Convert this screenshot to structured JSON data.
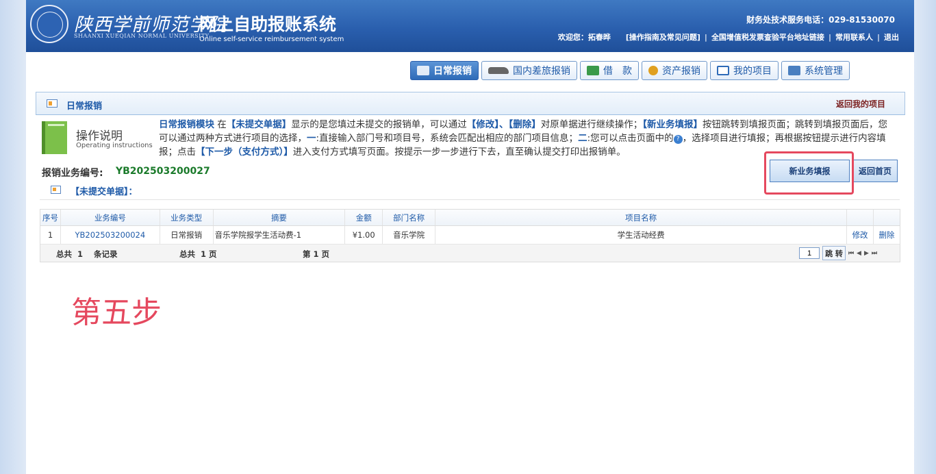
{
  "header": {
    "school_cn": "陕西学前师范学院",
    "school_en": "SHAANXI XUEQIAN NORMAL UNIVERSITY",
    "system_title": "网上自助报账系统",
    "system_subtitle": "Online self-service reimbursement system",
    "hotline": "财务处技术服务电话：029-81530070",
    "welcome": "欢迎您：拓春晔",
    "links": [
      "[操作指南及常见问题]",
      "全国增值税发票查验平台地址链接",
      "常用联系人",
      "退出"
    ]
  },
  "nav": [
    {
      "label": "日常报销",
      "active": true,
      "icon": "daily-icon",
      "color": "#2e6bb8"
    },
    {
      "label": "国内差旅报销",
      "active": false,
      "icon": "train-icon",
      "color": "#777777"
    },
    {
      "label": "借　款",
      "active": false,
      "icon": "loan-icon",
      "color": "#3a9a4a"
    },
    {
      "label": "资产报销",
      "active": false,
      "icon": "coins-icon",
      "color": "#e0a020"
    },
    {
      "label": "我的项目",
      "active": false,
      "icon": "list-icon",
      "color": "#2e6bb8"
    },
    {
      "label": "系统管理",
      "active": false,
      "icon": "system-icon",
      "color": "#4a7fc0"
    }
  ],
  "panel": {
    "title": "日常报销",
    "back_link": "返回我的项目"
  },
  "instructions": {
    "title_cn": "操作说明",
    "title_en": "Operating instructions",
    "segments": [
      {
        "t": "日常报销模块",
        "b": true
      },
      {
        "t": " 在",
        "b": false
      },
      {
        "t": "【未提交单据】",
        "b": true
      },
      {
        "t": "显示的是您填过未提交的报销单，可以通过",
        "b": false
      },
      {
        "t": "【修改】、【删除】",
        "b": true
      },
      {
        "t": "对原单据进行继续操作；",
        "b": false
      },
      {
        "t": "【新业务填报】",
        "b": true
      },
      {
        "t": "按钮跳转到填报页面；跳转到填报页面后，您可以通过两种方式进行项目的选择，",
        "b": false
      },
      {
        "t": "一",
        "b": true
      },
      {
        "t": ":直接输入部门号和项目号，系统会匹配出相应的部门项目信息；",
        "b": false
      },
      {
        "t": "二",
        "b": true
      },
      {
        "t": ":您可以点击页面中的",
        "b": false
      }
    ],
    "segments2": [
      {
        "t": "，选择项目进行填报；再根据按钮提示进行内容填报；点击",
        "b": false
      },
      {
        "t": "【下一步（支付方式）】",
        "b": true
      },
      {
        "t": "进入支付方式填写页面。按提示一步一步进行下去，直至确认提交打印出报销单。",
        "b": false
      }
    ],
    "help_icon": "?"
  },
  "business": {
    "label": "报销业务编号:",
    "value": "YB202503200027"
  },
  "buttons": {
    "new": "新业务填报",
    "home": "返回首页"
  },
  "unsubmitted": {
    "label": "【未提交单据】："
  },
  "table": {
    "headers": [
      "序号",
      "业务编号",
      "业务类型",
      "摘要",
      "金额",
      "部门名称",
      "项目名称",
      "",
      ""
    ],
    "rows": [
      [
        "1",
        "YB202503200024",
        "日常报销",
        "音乐学院报学生活动费-1",
        "¥1.00",
        "音乐学院",
        "学生活动经费",
        "修改",
        "删除"
      ]
    ],
    "footer": {
      "total_a": "总共",
      "total_a_num": "1",
      "total_a_unit": "条记录",
      "total_p": "总共",
      "total_p_num": "1",
      "total_p_unit": "页",
      "page_a": "第",
      "page_num": "1",
      "page_b": "页",
      "page_input": "1",
      "jump": "跳 转",
      "pager": [
        "⏮",
        "◀",
        "▶",
        "⏭"
      ]
    }
  },
  "annotation": {
    "step": "第五步"
  }
}
